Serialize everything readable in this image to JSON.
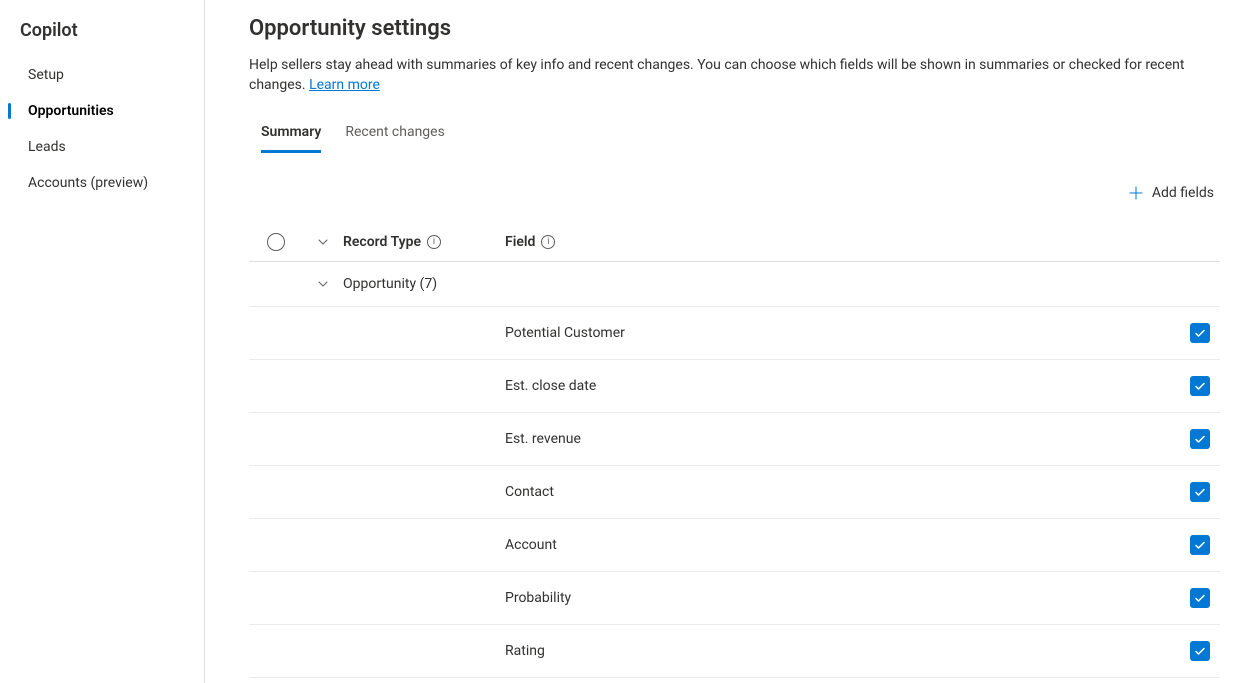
{
  "sidebar": {
    "title": "Copilot",
    "items": [
      {
        "label": "Setup",
        "active": false
      },
      {
        "label": "Opportunities",
        "active": true
      },
      {
        "label": "Leads",
        "active": false
      },
      {
        "label": "Accounts (preview)",
        "active": false
      }
    ]
  },
  "page": {
    "title": "Opportunity settings",
    "description_prefix": "Help sellers stay ahead with summaries of key info and recent changes. You can choose which fields will be shown in summaries or checked for recent changes. ",
    "learn_more": "Learn more"
  },
  "tabs": [
    {
      "label": "Summary",
      "active": true
    },
    {
      "label": "Recent changes",
      "active": false
    }
  ],
  "toolbar": {
    "add_fields": "Add fields"
  },
  "table": {
    "headers": {
      "record_type": "Record Type",
      "field": "Field"
    },
    "group_label": "Opportunity (7)",
    "rows": [
      {
        "field": "Potential Customer",
        "checked": true
      },
      {
        "field": "Est. close date",
        "checked": true
      },
      {
        "field": "Est. revenue",
        "checked": true
      },
      {
        "field": "Contact",
        "checked": true
      },
      {
        "field": "Account",
        "checked": true
      },
      {
        "field": "Probability",
        "checked": true
      },
      {
        "field": "Rating",
        "checked": true
      }
    ]
  }
}
